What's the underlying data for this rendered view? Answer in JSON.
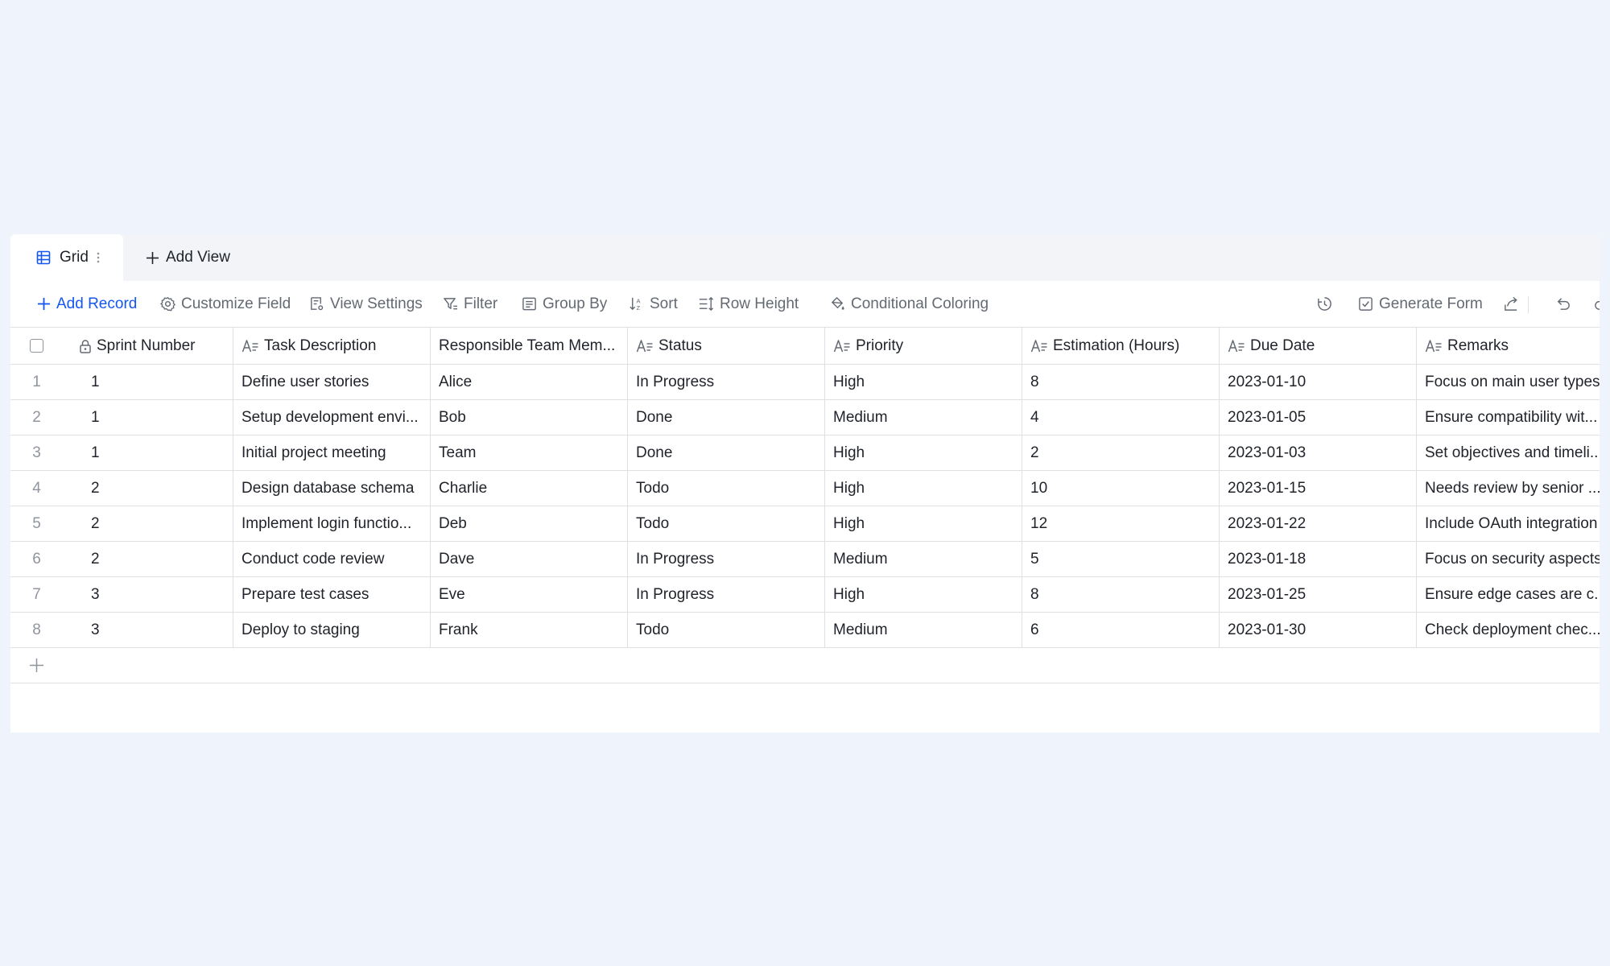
{
  "tabs": {
    "active_label": "Grid",
    "add_view_label": "Add View"
  },
  "toolbar": {
    "add_record": "Add Record",
    "customize_field": "Customize Field",
    "view_settings": "View Settings",
    "filter": "Filter",
    "group_by": "Group By",
    "sort": "Sort",
    "row_height": "Row Height",
    "conditional_coloring": "Conditional Coloring",
    "generate_form": "Generate Form"
  },
  "columns": [
    {
      "label": "Sprint Number",
      "icon": "lock-icon"
    },
    {
      "label": "Task Description",
      "icon": "text-field-icon"
    },
    {
      "label": "Responsible Team Mem...",
      "icon": "none"
    },
    {
      "label": "Status",
      "icon": "text-field-icon"
    },
    {
      "label": "Priority",
      "icon": "text-field-icon"
    },
    {
      "label": "Estimation (Hours)",
      "icon": "text-field-icon"
    },
    {
      "label": "Due Date",
      "icon": "text-field-icon"
    },
    {
      "label": "Remarks",
      "icon": "text-field-icon"
    }
  ],
  "rows": [
    {
      "num": "1",
      "cells": [
        "1",
        "Define user stories",
        "Alice",
        "In Progress",
        "High",
        "8",
        "2023-01-10",
        "Focus on main user types"
      ]
    },
    {
      "num": "2",
      "cells": [
        "1",
        "Setup development envi...",
        "Bob",
        "Done",
        "Medium",
        "4",
        "2023-01-05",
        "Ensure compatibility wit..."
      ]
    },
    {
      "num": "3",
      "cells": [
        "1",
        "Initial project meeting",
        "Team",
        "Done",
        "High",
        "2",
        "2023-01-03",
        "Set objectives and timeli..."
      ]
    },
    {
      "num": "4",
      "cells": [
        "2",
        "Design database schema",
        "Charlie",
        "Todo",
        "High",
        "10",
        "2023-01-15",
        "Needs review by senior ..."
      ]
    },
    {
      "num": "5",
      "cells": [
        "2",
        "Implement login functio...",
        "Deb",
        "Todo",
        "High",
        "12",
        "2023-01-22",
        "Include OAuth integration"
      ]
    },
    {
      "num": "6",
      "cells": [
        "2",
        "Conduct code review",
        "Dave",
        "In Progress",
        "Medium",
        "5",
        "2023-01-18",
        "Focus on security aspects"
      ]
    },
    {
      "num": "7",
      "cells": [
        "3",
        "Prepare test cases",
        "Eve",
        "In Progress",
        "High",
        "8",
        "2023-01-25",
        "Ensure edge cases are c..."
      ]
    },
    {
      "num": "8",
      "cells": [
        "3",
        "Deploy to staging",
        "Frank",
        "Todo",
        "Medium",
        "6",
        "2023-01-30",
        "Check deployment chec..."
      ]
    }
  ],
  "colors": {
    "accent": "#1456f0",
    "background": "#eef3fc",
    "border": "#dee0e3",
    "muted_text": "#646a73"
  }
}
